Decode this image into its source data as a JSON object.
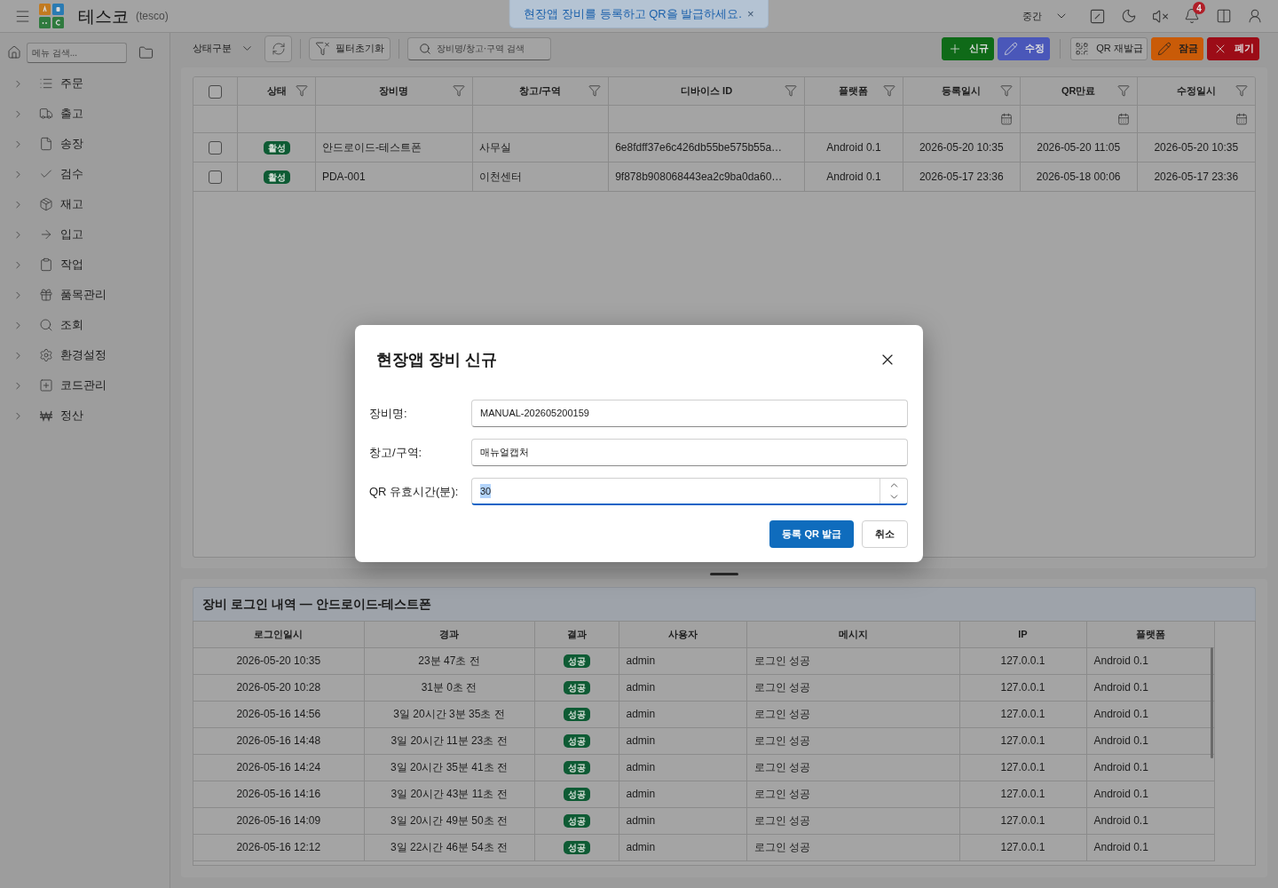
{
  "header": {
    "app_name": "테스코",
    "app_code": "(tesco)",
    "toast": {
      "message": "현장앱 장비를 등록하고 QR을 발급하세요.",
      "close": "×"
    },
    "density": "중간",
    "notification_count": "4"
  },
  "sidebar": {
    "search": {
      "placeholder": "메뉴 검색..."
    },
    "items": [
      {
        "label": "주문",
        "expanded": false
      },
      {
        "label": "출고",
        "expanded": false
      },
      {
        "label": "송장",
        "expanded": false
      },
      {
        "label": "검수",
        "expanded": false
      },
      {
        "label": "재고",
        "expanded": false
      },
      {
        "label": "입고",
        "expanded": false
      },
      {
        "label": "작업",
        "expanded": false
      },
      {
        "label": "품목관리",
        "expanded": false
      },
      {
        "label": "조회",
        "expanded": false
      },
      {
        "label": "환경설정",
        "expanded": false
      },
      {
        "label": "코드관리",
        "expanded": false
      },
      {
        "label": "정산",
        "expanded": false
      }
    ]
  },
  "toolbar": {
    "status_filter": "상태구분",
    "reset_filter": "필터초기화",
    "search": {
      "placeholder": "장비명/창고·구역 검색"
    },
    "actions": [
      {
        "label": "신규",
        "kind": "new"
      },
      {
        "label": "수정",
        "kind": "edit"
      },
      {
        "label": "QR 재발급",
        "kind": "qr"
      },
      {
        "label": "잠금",
        "kind": "lock"
      },
      {
        "label": "폐기",
        "kind": "discard"
      }
    ]
  },
  "device_table": {
    "select_all": {
      "checked": false
    },
    "columns": [
      {
        "label": "상태",
        "kind": "badge"
      },
      {
        "label": "장비명",
        "kind": "text"
      },
      {
        "label": "창고/구역",
        "kind": "text"
      },
      {
        "label": "디바이스 ID",
        "kind": "text"
      },
      {
        "label": "플랫폼",
        "kind": "text"
      },
      {
        "label": "등록일시",
        "kind": "date"
      },
      {
        "label": "QR만료",
        "kind": "date"
      },
      {
        "label": "수정일시",
        "kind": "date"
      }
    ],
    "rows": [
      {
        "checked": false,
        "cells": [
          "활성",
          "안드로이드-테스트폰",
          "사무실",
          "6e8fdff37e6c426db55be575b55a…",
          "Android 0.1",
          "2026-05-20 10:35",
          "2026-05-20 11:05",
          "2026-05-20 10:35"
        ]
      },
      {
        "checked": false,
        "cells": [
          "활성",
          "PDA-001",
          "이천센터",
          "9f878b908068443ea2c9ba0da60…",
          "Android 0.1",
          "2026-05-17 23:36",
          "2026-05-18 00:06",
          "2026-05-17 23:36"
        ]
      }
    ]
  },
  "log_panel": {
    "title": "장비 로그인 내역 — 안드로이드-테스트폰",
    "columns": [
      {
        "label": "로그인일시",
        "kind": "text"
      },
      {
        "label": "경과",
        "kind": "text"
      },
      {
        "label": "결과",
        "kind": "badge"
      },
      {
        "label": "사용자",
        "kind": "text"
      },
      {
        "label": "메시지",
        "kind": "text"
      },
      {
        "label": "IP",
        "kind": "text"
      },
      {
        "label": "플랫폼",
        "kind": "text"
      }
    ],
    "rows": [
      [
        "2026-05-20 10:35",
        "23분 47초 전",
        "성공",
        "admin",
        "로그인 성공",
        "127.0.0.1",
        "Android 0.1"
      ],
      [
        "2026-05-20 10:28",
        "31분 0초 전",
        "성공",
        "admin",
        "로그인 성공",
        "127.0.0.1",
        "Android 0.1"
      ],
      [
        "2026-05-16 14:56",
        "3일 20시간 3분 35초 전",
        "성공",
        "admin",
        "로그인 성공",
        "127.0.0.1",
        "Android 0.1"
      ],
      [
        "2026-05-16 14:48",
        "3일 20시간 11분 23초 전",
        "성공",
        "admin",
        "로그인 성공",
        "127.0.0.1",
        "Android 0.1"
      ],
      [
        "2026-05-16 14:24",
        "3일 20시간 35분 41초 전",
        "성공",
        "admin",
        "로그인 성공",
        "127.0.0.1",
        "Android 0.1"
      ],
      [
        "2026-05-16 14:16",
        "3일 20시간 43분 11초 전",
        "성공",
        "admin",
        "로그인 성공",
        "127.0.0.1",
        "Android 0.1"
      ],
      [
        "2026-05-16 14:09",
        "3일 20시간 49분 50초 전",
        "성공",
        "admin",
        "로그인 성공",
        "127.0.0.1",
        "Android 0.1"
      ],
      [
        "2026-05-16 12:12",
        "3일 22시간 46분 54초 전",
        "성공",
        "admin",
        "로그인 성공",
        "127.0.0.1",
        "Android 0.1"
      ]
    ]
  },
  "dialog": {
    "title": "현장앱 장비 신규",
    "fields": [
      {
        "label": "장비명:",
        "value": "MANUAL-202605200159",
        "kind": "text",
        "focused": false
      },
      {
        "label": "창고/구역:",
        "value": "매뉴얼캡처",
        "kind": "text",
        "focused": false
      },
      {
        "label": "QR 유효시간(분):",
        "value": "30",
        "kind": "number",
        "focused": true
      }
    ],
    "buttons": [
      {
        "label": "등록 QR 발급",
        "kind": "primary"
      },
      {
        "label": "취소",
        "kind": "secondary"
      }
    ]
  }
}
